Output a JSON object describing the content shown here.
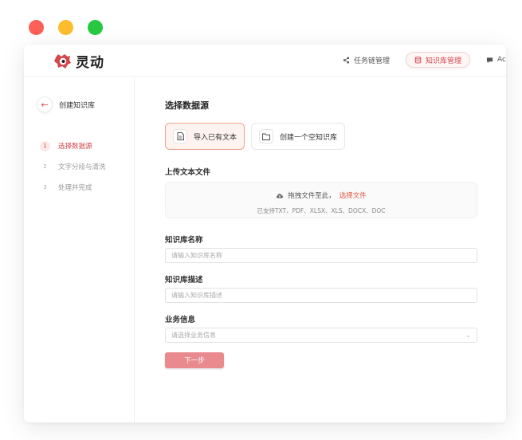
{
  "window_controls": {
    "colors": [
      "#fe5f57",
      "#febc2e",
      "#28c840"
    ]
  },
  "brand": {
    "name": "灵动",
    "accent": "#d3474d"
  },
  "nav": {
    "items": [
      {
        "label": "任务链管理",
        "icon": "share-icon"
      },
      {
        "label": "知识库管理",
        "icon": "database-icon",
        "active": true
      },
      {
        "label": "Ac",
        "icon": "chat-icon"
      }
    ]
  },
  "sidebar": {
    "back_label": "创建知识库",
    "steps": [
      {
        "num": "1",
        "label": "选择数据源",
        "active": true
      },
      {
        "num": "2",
        "label": "文字分段与清洗"
      },
      {
        "num": "3",
        "label": "处理并完成"
      }
    ]
  },
  "main": {
    "title": "选择数据源",
    "options": [
      {
        "label": "导入已有文本",
        "icon": "document-icon",
        "selected": true
      },
      {
        "label": "创建一个空知识库",
        "icon": "folder-icon"
      }
    ],
    "upload": {
      "label": "上传文本文件",
      "text": "拖拽文件至此，",
      "link": "选择文件",
      "formats": "已支持TXT、PDF、XLSX、XLS、DOCX、DOC"
    },
    "name_field": {
      "label": "知识库名称",
      "placeholder": "请输入知识库名称"
    },
    "desc_field": {
      "label": "知识库描述",
      "placeholder": "请输入知识库描述"
    },
    "biz_field": {
      "label": "业务信息",
      "placeholder": "请选择业务信息"
    },
    "next_label": "下一步"
  }
}
